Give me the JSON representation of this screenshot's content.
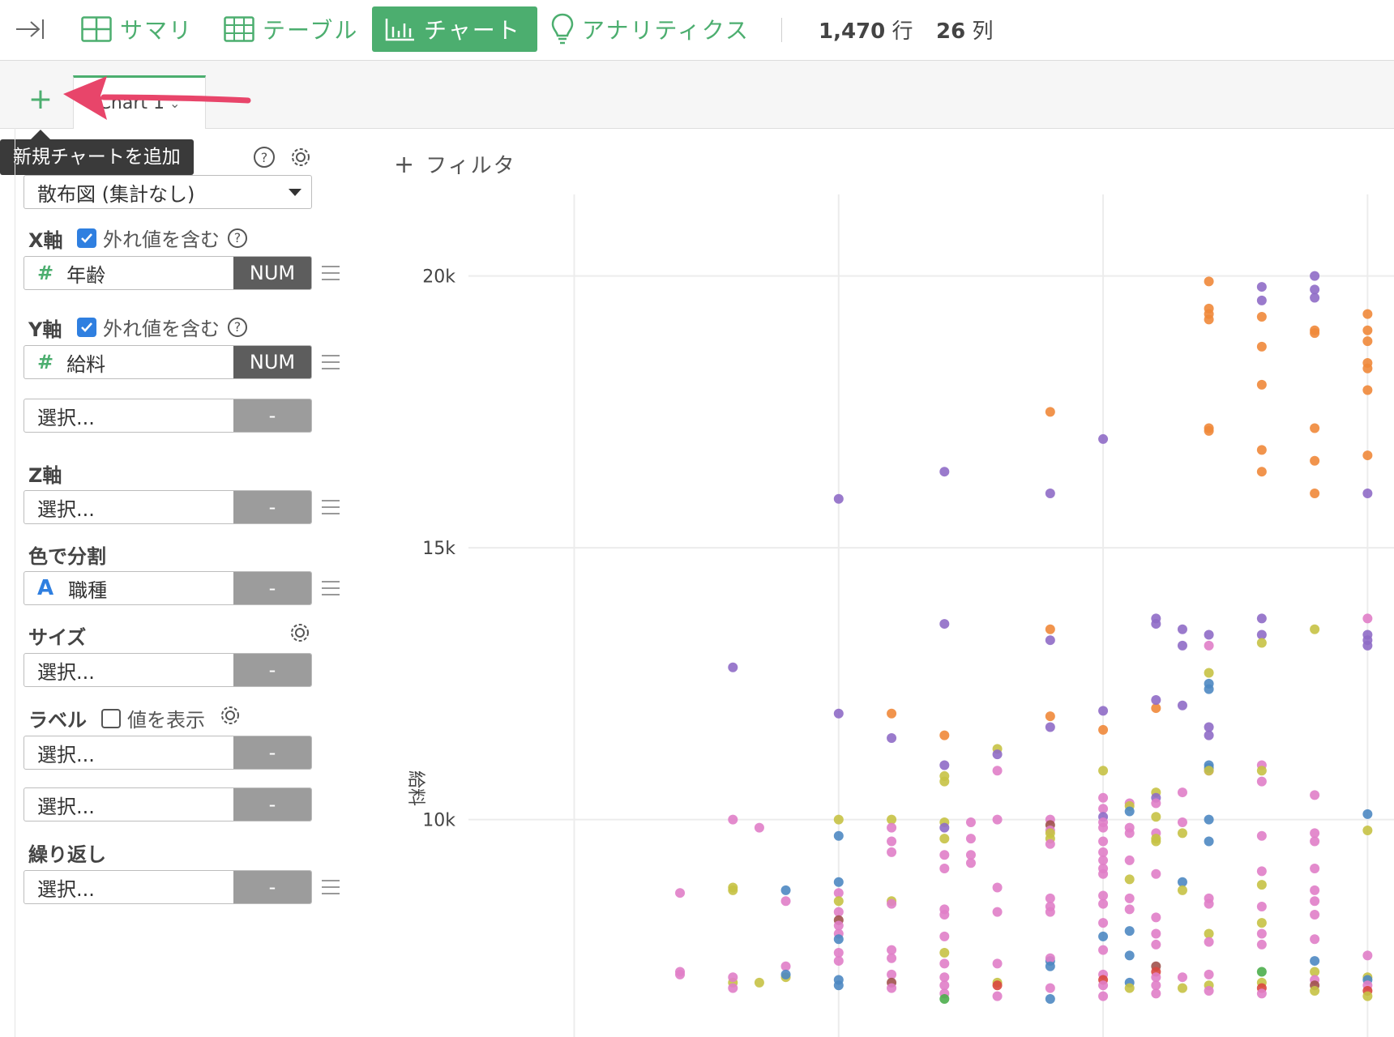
{
  "topbar": {
    "collapse_icon": "collapse-right-icon",
    "tabs": [
      {
        "label": "サマリ",
        "icon": "summary-grid-icon"
      },
      {
        "label": "テーブル",
        "icon": "table-icon"
      },
      {
        "label": "チャート",
        "icon": "bar-chart-icon",
        "active": true
      },
      {
        "label": "アナリティクス",
        "icon": "lightbulb-icon"
      }
    ],
    "rows_value": "1,470",
    "rows_unit": "行",
    "cols_value": "26",
    "cols_unit": "列"
  },
  "chart_tabs": {
    "add_symbol": "+",
    "tab_label": "Chart 1",
    "tooltip": "新規チャートを追加"
  },
  "panel": {
    "chart_type": "散布図 (集計なし)",
    "x_axis": {
      "label": "X軸",
      "checkbox_label": "外れ値を含む",
      "checked": true,
      "field": "年齢",
      "type": "NUM"
    },
    "y_axis": {
      "label": "Y軸",
      "checkbox_label": "外れ値を含む",
      "checked": true,
      "field": "給料",
      "type": "NUM",
      "extra_placeholder": "選択...",
      "extra_type": "-"
    },
    "z_axis": {
      "label": "Z軸",
      "placeholder": "選択...",
      "type": "-"
    },
    "color": {
      "label": "色で分割",
      "field": "職種",
      "type": "-"
    },
    "size": {
      "label": "サイズ",
      "placeholder": "選択...",
      "type": "-"
    },
    "label": {
      "label": "ラベル",
      "checkbox_label": "値を表示",
      "checked": false,
      "placeholder1": "選択...",
      "type1": "-",
      "placeholder2": "選択...",
      "type2": "-"
    },
    "repeat": {
      "label": "繰り返し",
      "placeholder": "選択...",
      "type": "-"
    }
  },
  "filter": {
    "label": "フィルタ"
  },
  "chart_data": {
    "type": "scatter",
    "xlabel": "",
    "ylabel": "給料",
    "ylim": [
      6000,
      21500
    ],
    "yticks": [
      10000,
      15000,
      20000
    ],
    "ytick_labels": [
      "10k",
      "15k",
      "20k"
    ],
    "xlim": [
      18,
      35.5
    ],
    "xgrid": [
      20,
      25,
      30,
      35
    ],
    "palette": [
      "#e07ec8",
      "#c7c245",
      "#4e88c2",
      "#8f6bc6",
      "#f0883a",
      "#a0524d",
      "#4cae4c",
      "#d9473f"
    ],
    "points": [
      {
        "x": 32,
        "y": 19900,
        "c": 4
      },
      {
        "x": 33,
        "y": 19800,
        "c": 3
      },
      {
        "x": 33,
        "y": 19550,
        "c": 3
      },
      {
        "x": 34,
        "y": 20000,
        "c": 3
      },
      {
        "x": 34,
        "y": 19750,
        "c": 3
      },
      {
        "x": 34,
        "y": 19600,
        "c": 3
      },
      {
        "x": 33,
        "y": 19250,
        "c": 4
      },
      {
        "x": 32,
        "y": 19400,
        "c": 4
      },
      {
        "x": 32,
        "y": 19300,
        "c": 4
      },
      {
        "x": 32,
        "y": 19200,
        "c": 4
      },
      {
        "x": 34,
        "y": 19000,
        "c": 4
      },
      {
        "x": 34,
        "y": 18950,
        "c": 4
      },
      {
        "x": 33,
        "y": 18700,
        "c": 4
      },
      {
        "x": 35,
        "y": 18800,
        "c": 4
      },
      {
        "x": 35,
        "y": 19300,
        "c": 4
      },
      {
        "x": 35,
        "y": 19000,
        "c": 4
      },
      {
        "x": 35,
        "y": 18400,
        "c": 4
      },
      {
        "x": 35,
        "y": 18300,
        "c": 4
      },
      {
        "x": 35,
        "y": 17900,
        "c": 4
      },
      {
        "x": 33,
        "y": 18000,
        "c": 4
      },
      {
        "x": 32,
        "y": 17200,
        "c": 4
      },
      {
        "x": 32,
        "y": 17150,
        "c": 4
      },
      {
        "x": 34,
        "y": 17200,
        "c": 4
      },
      {
        "x": 33,
        "y": 16800,
        "c": 4
      },
      {
        "x": 34,
        "y": 16600,
        "c": 4
      },
      {
        "x": 33,
        "y": 16400,
        "c": 4
      },
      {
        "x": 34,
        "y": 16000,
        "c": 4
      },
      {
        "x": 35,
        "y": 16700,
        "c": 4
      },
      {
        "x": 35,
        "y": 16000,
        "c": 3
      },
      {
        "x": 29,
        "y": 17500,
        "c": 4
      },
      {
        "x": 30,
        "y": 17000,
        "c": 3
      },
      {
        "x": 27,
        "y": 16400,
        "c": 3
      },
      {
        "x": 29,
        "y": 16000,
        "c": 3
      },
      {
        "x": 25,
        "y": 15900,
        "c": 3
      },
      {
        "x": 27,
        "y": 13600,
        "c": 3
      },
      {
        "x": 29,
        "y": 13500,
        "c": 4
      },
      {
        "x": 29,
        "y": 13300,
        "c": 3
      },
      {
        "x": 31,
        "y": 13700,
        "c": 3
      },
      {
        "x": 31,
        "y": 13600,
        "c": 3
      },
      {
        "x": 31.5,
        "y": 13500,
        "c": 3
      },
      {
        "x": 31.5,
        "y": 13200,
        "c": 3
      },
      {
        "x": 32,
        "y": 13400,
        "c": 3
      },
      {
        "x": 32,
        "y": 13200,
        "c": 0
      },
      {
        "x": 33,
        "y": 13700,
        "c": 3
      },
      {
        "x": 33,
        "y": 13400,
        "c": 3
      },
      {
        "x": 33,
        "y": 13250,
        "c": 1
      },
      {
        "x": 34,
        "y": 13500,
        "c": 1
      },
      {
        "x": 35,
        "y": 13700,
        "c": 0
      },
      {
        "x": 35,
        "y": 13400,
        "c": 3
      },
      {
        "x": 35,
        "y": 13300,
        "c": 3
      },
      {
        "x": 35,
        "y": 13200,
        "c": 3
      },
      {
        "x": 23,
        "y": 12800,
        "c": 3
      },
      {
        "x": 32,
        "y": 12700,
        "c": 1
      },
      {
        "x": 32,
        "y": 12500,
        "c": 2
      },
      {
        "x": 32,
        "y": 12400,
        "c": 2
      },
      {
        "x": 25,
        "y": 11950,
        "c": 3
      },
      {
        "x": 26,
        "y": 11950,
        "c": 4
      },
      {
        "x": 26,
        "y": 11500,
        "c": 3
      },
      {
        "x": 27,
        "y": 11550,
        "c": 4
      },
      {
        "x": 28,
        "y": 11300,
        "c": 1
      },
      {
        "x": 28,
        "y": 11200,
        "c": 3
      },
      {
        "x": 29,
        "y": 11900,
        "c": 4
      },
      {
        "x": 29,
        "y": 11700,
        "c": 3
      },
      {
        "x": 30,
        "y": 12000,
        "c": 3
      },
      {
        "x": 30,
        "y": 11650,
        "c": 4
      },
      {
        "x": 31,
        "y": 12050,
        "c": 4
      },
      {
        "x": 32,
        "y": 11700,
        "c": 3
      },
      {
        "x": 32,
        "y": 11550,
        "c": 3
      },
      {
        "x": 31,
        "y": 12200,
        "c": 3
      },
      {
        "x": 31.5,
        "y": 12100,
        "c": 3
      },
      {
        "x": 27,
        "y": 11000,
        "c": 3
      },
      {
        "x": 27,
        "y": 10800,
        "c": 1
      },
      {
        "x": 27,
        "y": 10700,
        "c": 1
      },
      {
        "x": 28,
        "y": 10900,
        "c": 0
      },
      {
        "x": 30,
        "y": 10900,
        "c": 1
      },
      {
        "x": 30,
        "y": 10400,
        "c": 0
      },
      {
        "x": 31,
        "y": 10500,
        "c": 1
      },
      {
        "x": 31,
        "y": 10400,
        "c": 3
      },
      {
        "x": 31,
        "y": 10300,
        "c": 0
      },
      {
        "x": 31.5,
        "y": 10500,
        "c": 0
      },
      {
        "x": 32,
        "y": 10900,
        "c": 0
      },
      {
        "x": 32,
        "y": 11000,
        "c": 2
      },
      {
        "x": 32,
        "y": 10950,
        "c": 2
      },
      {
        "x": 32,
        "y": 10900,
        "c": 1
      },
      {
        "x": 33,
        "y": 11000,
        "c": 0
      },
      {
        "x": 33,
        "y": 10900,
        "c": 1
      },
      {
        "x": 33,
        "y": 10700,
        "c": 0
      },
      {
        "x": 34,
        "y": 10450,
        "c": 0
      },
      {
        "x": 35,
        "y": 10100,
        "c": 2
      },
      {
        "x": 23,
        "y": 10000,
        "c": 0
      },
      {
        "x": 23.5,
        "y": 9850,
        "c": 0
      },
      {
        "x": 25,
        "y": 10000,
        "c": 1
      },
      {
        "x": 25,
        "y": 9700,
        "c": 2
      },
      {
        "x": 26,
        "y": 10000,
        "c": 1
      },
      {
        "x": 26,
        "y": 9850,
        "c": 0
      },
      {
        "x": 26,
        "y": 9600,
        "c": 0
      },
      {
        "x": 26,
        "y": 9400,
        "c": 0
      },
      {
        "x": 27,
        "y": 9950,
        "c": 1
      },
      {
        "x": 27,
        "y": 9850,
        "c": 3
      },
      {
        "x": 27,
        "y": 9650,
        "c": 1
      },
      {
        "x": 27,
        "y": 9350,
        "c": 0
      },
      {
        "x": 27,
        "y": 9100,
        "c": 0
      },
      {
        "x": 27.5,
        "y": 9950,
        "c": 0
      },
      {
        "x": 27.5,
        "y": 9650,
        "c": 0
      },
      {
        "x": 27.5,
        "y": 9350,
        "c": 0
      },
      {
        "x": 27.5,
        "y": 9200,
        "c": 0
      },
      {
        "x": 28,
        "y": 10000,
        "c": 0
      },
      {
        "x": 29,
        "y": 10000,
        "c": 0
      },
      {
        "x": 29,
        "y": 9900,
        "c": 5
      },
      {
        "x": 29,
        "y": 9800,
        "c": 0
      },
      {
        "x": 29,
        "y": 9750,
        "c": 1
      },
      {
        "x": 29,
        "y": 9650,
        "c": 1
      },
      {
        "x": 29,
        "y": 9550,
        "c": 0
      },
      {
        "x": 30,
        "y": 10200,
        "c": 0
      },
      {
        "x": 30,
        "y": 10050,
        "c": 3
      },
      {
        "x": 30,
        "y": 9950,
        "c": 0
      },
      {
        "x": 30,
        "y": 9850,
        "c": 0
      },
      {
        "x": 30,
        "y": 9600,
        "c": 0
      },
      {
        "x": 30,
        "y": 9400,
        "c": 0
      },
      {
        "x": 30,
        "y": 9250,
        "c": 0
      },
      {
        "x": 30,
        "y": 9100,
        "c": 0
      },
      {
        "x": 30,
        "y": 9000,
        "c": 0
      },
      {
        "x": 30.5,
        "y": 10300,
        "c": 0
      },
      {
        "x": 30.5,
        "y": 10250,
        "c": 1
      },
      {
        "x": 30.5,
        "y": 10150,
        "c": 2
      },
      {
        "x": 30.5,
        "y": 9850,
        "c": 0
      },
      {
        "x": 30.5,
        "y": 9750,
        "c": 0
      },
      {
        "x": 30.5,
        "y": 9250,
        "c": 0
      },
      {
        "x": 30.5,
        "y": 8900,
        "c": 1
      },
      {
        "x": 31,
        "y": 10050,
        "c": 1
      },
      {
        "x": 31,
        "y": 9750,
        "c": 0
      },
      {
        "x": 31,
        "y": 9650,
        "c": 1
      },
      {
        "x": 31,
        "y": 9600,
        "c": 1
      },
      {
        "x": 31,
        "y": 9000,
        "c": 0
      },
      {
        "x": 31.5,
        "y": 9950,
        "c": 0
      },
      {
        "x": 31.5,
        "y": 9750,
        "c": 1
      },
      {
        "x": 31.5,
        "y": 8850,
        "c": 2
      },
      {
        "x": 32,
        "y": 10000,
        "c": 2
      },
      {
        "x": 32,
        "y": 9600,
        "c": 2
      },
      {
        "x": 33,
        "y": 9700,
        "c": 0
      },
      {
        "x": 33,
        "y": 9050,
        "c": 0
      },
      {
        "x": 33,
        "y": 8800,
        "c": 1
      },
      {
        "x": 34,
        "y": 9750,
        "c": 0
      },
      {
        "x": 34,
        "y": 9600,
        "c": 0
      },
      {
        "x": 34,
        "y": 9100,
        "c": 0
      },
      {
        "x": 34,
        "y": 8700,
        "c": 0
      },
      {
        "x": 34,
        "y": 8500,
        "c": 0
      },
      {
        "x": 35,
        "y": 9800,
        "c": 1
      },
      {
        "x": 22,
        "y": 8650,
        "c": 0
      },
      {
        "x": 23,
        "y": 8750,
        "c": 1
      },
      {
        "x": 23,
        "y": 8700,
        "c": 1
      },
      {
        "x": 24,
        "y": 8700,
        "c": 2
      },
      {
        "x": 24,
        "y": 8500,
        "c": 0
      },
      {
        "x": 25,
        "y": 8850,
        "c": 2
      },
      {
        "x": 25,
        "y": 8650,
        "c": 0
      },
      {
        "x": 25,
        "y": 8500,
        "c": 1
      },
      {
        "x": 25,
        "y": 8300,
        "c": 0
      },
      {
        "x": 25,
        "y": 8150,
        "c": 5
      },
      {
        "x": 25,
        "y": 8050,
        "c": 0
      },
      {
        "x": 25,
        "y": 7900,
        "c": 0
      },
      {
        "x": 25,
        "y": 7800,
        "c": 2
      },
      {
        "x": 25,
        "y": 7550,
        "c": 0
      },
      {
        "x": 25,
        "y": 7400,
        "c": 0
      },
      {
        "x": 26,
        "y": 8500,
        "c": 1
      },
      {
        "x": 26,
        "y": 8450,
        "c": 0
      },
      {
        "x": 26,
        "y": 7600,
        "c": 0
      },
      {
        "x": 26,
        "y": 7450,
        "c": 0
      },
      {
        "x": 27,
        "y": 8350,
        "c": 0
      },
      {
        "x": 27,
        "y": 8250,
        "c": 0
      },
      {
        "x": 27,
        "y": 7850,
        "c": 0
      },
      {
        "x": 27,
        "y": 7550,
        "c": 1
      },
      {
        "x": 27,
        "y": 7350,
        "c": 0
      },
      {
        "x": 28,
        "y": 8750,
        "c": 0
      },
      {
        "x": 28,
        "y": 8300,
        "c": 0
      },
      {
        "x": 28,
        "y": 7350,
        "c": 0
      },
      {
        "x": 29,
        "y": 8550,
        "c": 0
      },
      {
        "x": 29,
        "y": 8400,
        "c": 0
      },
      {
        "x": 29,
        "y": 8300,
        "c": 0
      },
      {
        "x": 29,
        "y": 7400,
        "c": 2
      },
      {
        "x": 29,
        "y": 7450,
        "c": 0
      },
      {
        "x": 29,
        "y": 7300,
        "c": 2
      },
      {
        "x": 30,
        "y": 8600,
        "c": 0
      },
      {
        "x": 30,
        "y": 8450,
        "c": 0
      },
      {
        "x": 30,
        "y": 8100,
        "c": 0
      },
      {
        "x": 30,
        "y": 7850,
        "c": 2
      },
      {
        "x": 30,
        "y": 7600,
        "c": 0
      },
      {
        "x": 30.5,
        "y": 8550,
        "c": 0
      },
      {
        "x": 30.5,
        "y": 8350,
        "c": 0
      },
      {
        "x": 30.5,
        "y": 7950,
        "c": 2
      },
      {
        "x": 30.5,
        "y": 7500,
        "c": 2
      },
      {
        "x": 31,
        "y": 8200,
        "c": 0
      },
      {
        "x": 31,
        "y": 7900,
        "c": 0
      },
      {
        "x": 31,
        "y": 7700,
        "c": 0
      },
      {
        "x": 31.5,
        "y": 8700,
        "c": 1
      },
      {
        "x": 32,
        "y": 8550,
        "c": 0
      },
      {
        "x": 32,
        "y": 8450,
        "c": 0
      },
      {
        "x": 32,
        "y": 7900,
        "c": 1
      },
      {
        "x": 32,
        "y": 7750,
        "c": 0
      },
      {
        "x": 33,
        "y": 8400,
        "c": 0
      },
      {
        "x": 33,
        "y": 8100,
        "c": 1
      },
      {
        "x": 33,
        "y": 7900,
        "c": 0
      },
      {
        "x": 33,
        "y": 7700,
        "c": 0
      },
      {
        "x": 34,
        "y": 8250,
        "c": 0
      },
      {
        "x": 34,
        "y": 7800,
        "c": 0
      },
      {
        "x": 34,
        "y": 7400,
        "c": 2
      },
      {
        "x": 34,
        "y": 7200,
        "c": 1
      },
      {
        "x": 35,
        "y": 7500,
        "c": 0
      },
      {
        "x": 35,
        "y": 7100,
        "c": 1
      },
      {
        "x": 35,
        "y": 7050,
        "c": 2
      },
      {
        "x": 22,
        "y": 7200,
        "c": 0
      },
      {
        "x": 22,
        "y": 7150,
        "c": 0
      },
      {
        "x": 23,
        "y": 7000,
        "c": 1
      },
      {
        "x": 23,
        "y": 6900,
        "c": 0
      },
      {
        "x": 23,
        "y": 7100,
        "c": 0
      },
      {
        "x": 23.5,
        "y": 7000,
        "c": 1
      },
      {
        "x": 24,
        "y": 7300,
        "c": 0
      },
      {
        "x": 24,
        "y": 7100,
        "c": 1
      },
      {
        "x": 24,
        "y": 7150,
        "c": 2
      },
      {
        "x": 25,
        "y": 7050,
        "c": 2
      },
      {
        "x": 25,
        "y": 6950,
        "c": 2
      },
      {
        "x": 26,
        "y": 7150,
        "c": 0
      },
      {
        "x": 26,
        "y": 7000,
        "c": 5
      },
      {
        "x": 26,
        "y": 6900,
        "c": 0
      },
      {
        "x": 27,
        "y": 7100,
        "c": 0
      },
      {
        "x": 27,
        "y": 6950,
        "c": 0
      },
      {
        "x": 27,
        "y": 6800,
        "c": 0
      },
      {
        "x": 27,
        "y": 6700,
        "c": 6
      },
      {
        "x": 28,
        "y": 7000,
        "c": 1
      },
      {
        "x": 28,
        "y": 6950,
        "c": 7
      },
      {
        "x": 28,
        "y": 6750,
        "c": 0
      },
      {
        "x": 29,
        "y": 6900,
        "c": 0
      },
      {
        "x": 29,
        "y": 6700,
        "c": 2
      },
      {
        "x": 30,
        "y": 7150,
        "c": 0
      },
      {
        "x": 30,
        "y": 7050,
        "c": 7
      },
      {
        "x": 30,
        "y": 6950,
        "c": 0
      },
      {
        "x": 30,
        "y": 6750,
        "c": 0
      },
      {
        "x": 30.5,
        "y": 7000,
        "c": 2
      },
      {
        "x": 30.5,
        "y": 6900,
        "c": 1
      },
      {
        "x": 31,
        "y": 7300,
        "c": 5
      },
      {
        "x": 31,
        "y": 7200,
        "c": 7
      },
      {
        "x": 31,
        "y": 7100,
        "c": 0
      },
      {
        "x": 31,
        "y": 6950,
        "c": 0
      },
      {
        "x": 31,
        "y": 6800,
        "c": 0
      },
      {
        "x": 31.5,
        "y": 7100,
        "c": 0
      },
      {
        "x": 31.5,
        "y": 6900,
        "c": 1
      },
      {
        "x": 32,
        "y": 7150,
        "c": 0
      },
      {
        "x": 32,
        "y": 6950,
        "c": 1
      },
      {
        "x": 32,
        "y": 6850,
        "c": 0
      },
      {
        "x": 33,
        "y": 7200,
        "c": 6
      },
      {
        "x": 33,
        "y": 7000,
        "c": 1
      },
      {
        "x": 33,
        "y": 6900,
        "c": 7
      },
      {
        "x": 33,
        "y": 6800,
        "c": 0
      },
      {
        "x": 34,
        "y": 7050,
        "c": 0
      },
      {
        "x": 34,
        "y": 6950,
        "c": 5
      },
      {
        "x": 34,
        "y": 6850,
        "c": 1
      },
      {
        "x": 35,
        "y": 6950,
        "c": 0
      },
      {
        "x": 35,
        "y": 6850,
        "c": 7
      },
      {
        "x": 35,
        "y": 6750,
        "c": 1
      }
    ]
  }
}
